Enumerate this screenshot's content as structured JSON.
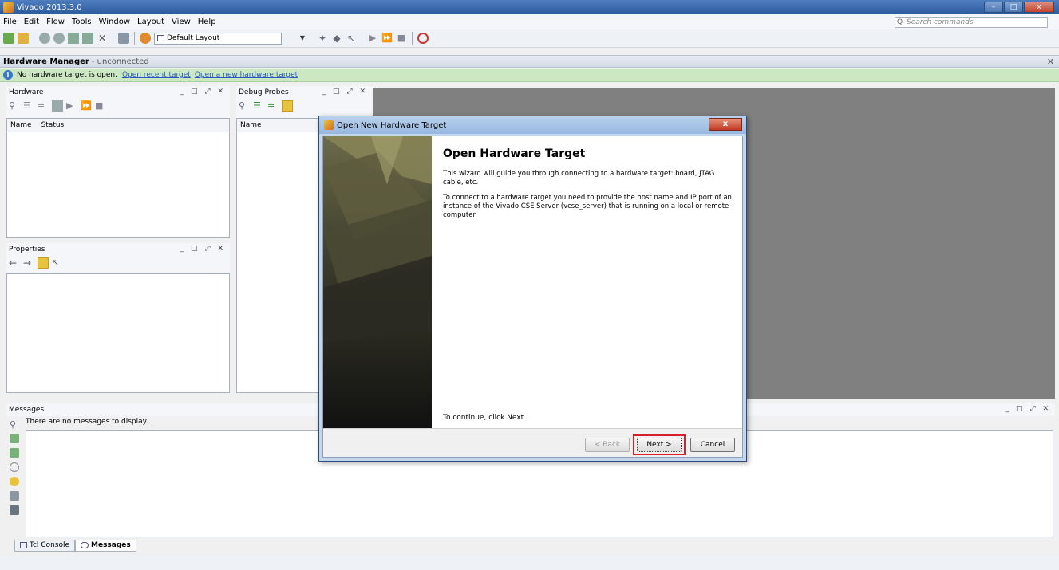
{
  "window": {
    "title": "Vivado 2013.3.0"
  },
  "menu": [
    "File",
    "Edit",
    "Flow",
    "Tools",
    "Window",
    "Layout",
    "View",
    "Help"
  ],
  "search": {
    "placeholder": "Search commands"
  },
  "toolbar": {
    "layout_value": "Default Layout"
  },
  "hardware_manager": {
    "title": "Hardware Manager",
    "status": "- unconnected"
  },
  "infobar": {
    "message": "No hardware target is open.",
    "link_recent": "Open recent target",
    "link_new": "Open a new hardware target"
  },
  "panels": {
    "hardware": {
      "title": "Hardware",
      "columns": [
        "Name",
        "Status"
      ]
    },
    "debug_probes": {
      "title": "Debug Probes",
      "columns": [
        "Name"
      ]
    },
    "properties": {
      "title": "Properties"
    },
    "messages": {
      "title": "Messages",
      "empty_text": "There are no messages to display."
    }
  },
  "bottom_tabs": [
    "Tcl Console",
    "Messages"
  ],
  "dialog": {
    "title": "Open New Hardware Target",
    "close_glyph": "x",
    "heading": "Open Hardware Target",
    "para1": "This wizard will guide you through connecting to a hardware target: board, JTAG cable, etc.",
    "para2": "To connect to a hardware target you need to provide the host name and IP port of an instance of the Vivado CSE Server (vcse_server) that is running on a local or remote computer.",
    "continue_text": "To continue, click Next.",
    "buttons": {
      "back": "< Back",
      "next": "Next >",
      "cancel": "Cancel"
    }
  },
  "colors": {
    "title_bar": "#2d5a9c",
    "infobar_bg": "#cbe8c2",
    "highlight": "#d8202a",
    "workspace": "#808080"
  }
}
